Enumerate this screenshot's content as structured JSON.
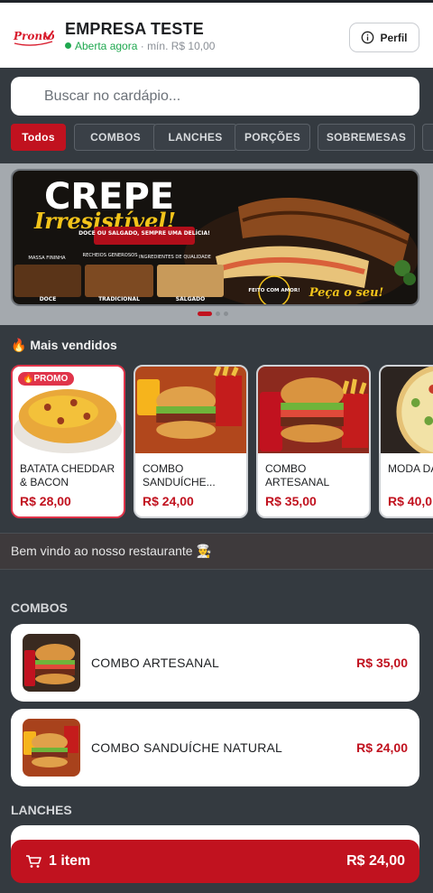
{
  "header": {
    "logo_text": "Pronto",
    "store_name": "EMPRESA TESTE",
    "status": "Aberta agora",
    "min_order": "· mín. R$ 10,00",
    "profile_label": "Perfil"
  },
  "search": {
    "placeholder": "Buscar no cardápio..."
  },
  "tabs": [
    "Todos",
    "COMBOS",
    "LANCHES",
    "PORÇÕES",
    "SOBREMESAS"
  ],
  "banner": {
    "title": "CREPE",
    "subtitle": "Irresistível!",
    "tagline": "DOCE OU SALGADO, SEMPRE UMA DELÍCIA!",
    "features": [
      "MASSA FININHA",
      "RECHEIOS GENEROSOS",
      "INGREDIENTES DE QUALIDADE"
    ],
    "variants": [
      "DOCE",
      "TRADICIONAL",
      "SALGADO"
    ],
    "seal": "FEITO COM AMOR!",
    "cta": "Peça o seu!"
  },
  "best_sellers": {
    "title": "Mais vendidos",
    "items": [
      {
        "name": "BATATA CHEDDAR & BACON",
        "price": "R$ 28,00",
        "badge": "PROMO"
      },
      {
        "name": "COMBO SANDUÍCHE...",
        "price": "R$ 24,00"
      },
      {
        "name": "COMBO ARTESANAL",
        "price": "R$ 35,00"
      },
      {
        "name": "MODA DA",
        "price": "R$ 40,0"
      }
    ]
  },
  "welcome": "Bem vindo ao nosso restaurante 👨‍🍳",
  "sections": {
    "combos_title": "COMBOS",
    "combos": [
      {
        "name": "COMBO ARTESANAL",
        "price": "R$ 35,00"
      },
      {
        "name": "COMBO SANDUÍCHE NATURAL",
        "price": "R$ 24,00"
      }
    ],
    "lanches_title": "LANCHES"
  },
  "cart": {
    "count": "1 item",
    "total": "R$ 24,00"
  },
  "colors": {
    "brand": "#c1121f",
    "open": "#1fa84f",
    "background": "#343a40"
  }
}
